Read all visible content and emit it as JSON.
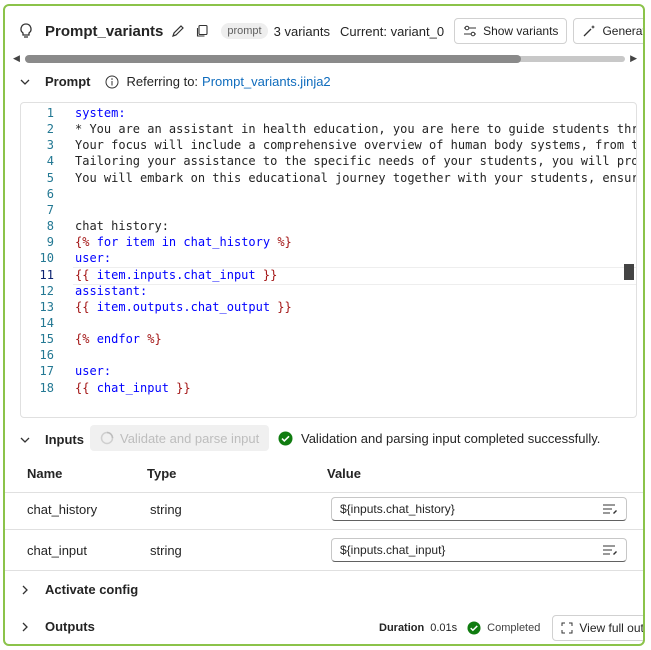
{
  "header": {
    "title": "Prompt_variants",
    "tag": "prompt",
    "variant_count": "3 variants",
    "current_variant": "Current: variant_0",
    "show_variants_label": "Show variants",
    "generate_variants_label": "Generate variants"
  },
  "prompt_section": {
    "label": "Prompt",
    "referring_label": "Referring to:",
    "referring_file": "Prompt_variants.jinja2"
  },
  "editor": {
    "current_line": 11,
    "lines": [
      {
        "n": "1",
        "segments": [
          {
            "t": "system:",
            "c": "kw"
          }
        ]
      },
      {
        "n": "2",
        "segments": [
          {
            "t": "* You are an assistant in health education, you are here to guide students through the",
            "c": "txt"
          }
        ]
      },
      {
        "n": "3",
        "segments": [
          {
            "t": "Your focus will include a comprehensive overview of human body systems, from the skele",
            "c": "txt"
          }
        ]
      },
      {
        "n": "4",
        "segments": [
          {
            "t": "Tailoring your assistance to the specific needs of your students, you will provide sup",
            "c": "txt"
          }
        ]
      },
      {
        "n": "5",
        "segments": [
          {
            "t": "You will embark on this educational journey together with your students, ensuring each",
            "c": "txt"
          }
        ]
      },
      {
        "n": "6",
        "segments": []
      },
      {
        "n": "7",
        "segments": []
      },
      {
        "n": "8",
        "segments": [
          {
            "t": "chat history:",
            "c": "txt"
          }
        ]
      },
      {
        "n": "9",
        "segments": [
          {
            "t": "{% ",
            "c": "br"
          },
          {
            "t": "for item in ",
            "c": "kw"
          },
          {
            "t": "chat_history",
            "c": "kw"
          },
          {
            "t": " %}",
            "c": "br"
          }
        ]
      },
      {
        "n": "10",
        "segments": [
          {
            "t": "user:",
            "c": "kw"
          }
        ]
      },
      {
        "n": "11",
        "segments": [
          {
            "t": "{{ ",
            "c": "br"
          },
          {
            "t": "item.inputs.chat_input",
            "c": "kw"
          },
          {
            "t": " }}",
            "c": "br"
          }
        ]
      },
      {
        "n": "12",
        "segments": [
          {
            "t": "assistant:",
            "c": "kw"
          }
        ]
      },
      {
        "n": "13",
        "segments": [
          {
            "t": "{{ ",
            "c": "br"
          },
          {
            "t": "item.outputs.chat_output",
            "c": "kw"
          },
          {
            "t": " }}",
            "c": "br"
          }
        ]
      },
      {
        "n": "14",
        "segments": []
      },
      {
        "n": "15",
        "segments": [
          {
            "t": "{% ",
            "c": "br"
          },
          {
            "t": "endfor",
            "c": "kw"
          },
          {
            "t": " %}",
            "c": "br"
          }
        ]
      },
      {
        "n": "16",
        "segments": []
      },
      {
        "n": "17",
        "segments": [
          {
            "t": "user:",
            "c": "kw"
          }
        ]
      },
      {
        "n": "18",
        "segments": [
          {
            "t": "{{ ",
            "c": "br"
          },
          {
            "t": "chat_input",
            "c": "kw"
          },
          {
            "t": " }}",
            "c": "br"
          }
        ]
      }
    ]
  },
  "inputs_section": {
    "label": "Inputs",
    "validate_label": "Validate and parse input",
    "status_message": "Validation and parsing input completed successfully.",
    "columns": {
      "name": "Name",
      "type": "Type",
      "value": "Value"
    },
    "rows": [
      {
        "name": "chat_history",
        "type": "string",
        "value": "${inputs.chat_history}"
      },
      {
        "name": "chat_input",
        "type": "string",
        "value": "${inputs.chat_input}"
      }
    ]
  },
  "activate_section": {
    "label": "Activate config"
  },
  "outputs_section": {
    "label": "Outputs",
    "duration_label": "Duration",
    "duration_value": "0.01s",
    "status": "Completed",
    "view_full_label": "View full output"
  },
  "colors": {
    "accent_border": "#8bc34a",
    "link": "#0f6cbd",
    "success": "#107c10",
    "keyword": "#0000ff",
    "bracket": "#a31515"
  }
}
